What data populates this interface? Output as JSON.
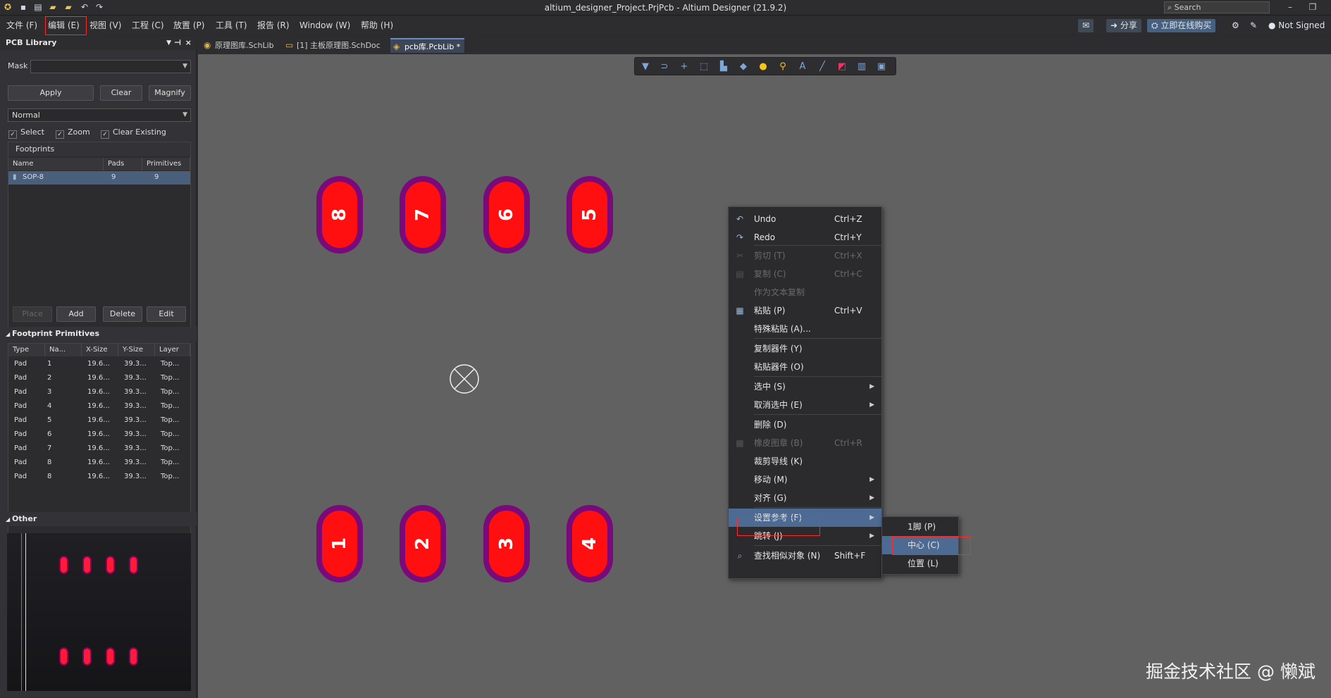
{
  "window": {
    "title": "altium_designer_Project.PrjPcb - Altium Designer (21.9.2)",
    "search_placeholder": "Search",
    "min_label": "–",
    "max_label": "❐"
  },
  "quick_access": [
    "logo-icon",
    "save-icon",
    "save-all-icon",
    "open-icon",
    "open-project-icon",
    "undo-icon",
    "redo-icon"
  ],
  "menu": [
    "文件 (F)",
    "编辑 (E)",
    "视图 (V)",
    "工程 (C)",
    "放置 (P)",
    "工具 (T)",
    "报告 (R)",
    "Window (W)",
    "帮助 (H)"
  ],
  "right_bar": {
    "share": "分享",
    "buy": "立即在线购买",
    "user": "Not Signed"
  },
  "panel": {
    "title": "PCB Library",
    "mask_label": "Mask",
    "mask_value": "",
    "apply": "Apply",
    "clear": "Clear",
    "magnify": "Magnify",
    "mode": "Normal",
    "select": "Select",
    "zoom": "Zoom",
    "clear_existing": "Clear Existing",
    "footprints_title": "Footprints",
    "footprint_columns": [
      "Name",
      "Pads",
      "Primitives"
    ],
    "footprints": [
      {
        "name": "SOP-8",
        "pads": "9",
        "primitives": "9"
      }
    ],
    "place": "Place",
    "add": "Add",
    "delete": "Delete",
    "edit": "Edit",
    "primitives_title": "Footprint Primitives",
    "primitive_columns": [
      "Type",
      "Na...",
      "X-Size",
      "Y-Size",
      "Layer"
    ],
    "primitives": [
      {
        "type": "Pad",
        "name": "1",
        "x": "19.6...",
        "y": "39.3...",
        "layer": "Top..."
      },
      {
        "type": "Pad",
        "name": "2",
        "x": "19.6...",
        "y": "39.3...",
        "layer": "Top..."
      },
      {
        "type": "Pad",
        "name": "3",
        "x": "19.6...",
        "y": "39.3...",
        "layer": "Top..."
      },
      {
        "type": "Pad",
        "name": "4",
        "x": "19.6...",
        "y": "39.3...",
        "layer": "Top..."
      },
      {
        "type": "Pad",
        "name": "5",
        "x": "19.6...",
        "y": "39.3...",
        "layer": "Top..."
      },
      {
        "type": "Pad",
        "name": "6",
        "x": "19.6...",
        "y": "39.3...",
        "layer": "Top..."
      },
      {
        "type": "Pad",
        "name": "7",
        "x": "19.6...",
        "y": "39.3...",
        "layer": "Top..."
      },
      {
        "type": "Pad",
        "name": "8",
        "x": "19.6...",
        "y": "39.3...",
        "layer": "Top..."
      },
      {
        "type": "Pad",
        "name": "8",
        "x": "19.6...",
        "y": "39.3...",
        "layer": "Top..."
      }
    ],
    "other_title": "Other"
  },
  "tabs": [
    {
      "label": "原理图库.SchLib",
      "icon": "schlib-icon"
    },
    {
      "label": "[1] 主板原理图.SchDoc",
      "icon": "schdoc-icon"
    },
    {
      "label": "pcb库.PcbLib *",
      "icon": "pcblib-icon"
    }
  ],
  "pads_top": [
    "8",
    "7",
    "6",
    "5"
  ],
  "pads_bottom": [
    "1",
    "2",
    "3",
    "4"
  ],
  "context_menu": [
    {
      "label": "Undo",
      "shortcut": "Ctrl+Z",
      "icon": "undo-icon",
      "disabled": false
    },
    {
      "label": "Redo",
      "shortcut": "Ctrl+Y",
      "icon": "redo-icon",
      "disabled": false
    },
    {
      "label": "剪切 (T)",
      "shortcut": "Ctrl+X",
      "icon": "cut-icon",
      "disabled": true
    },
    {
      "label": "复制 (C)",
      "shortcut": "Ctrl+C",
      "icon": "copy-icon",
      "disabled": true
    },
    {
      "label": "作为文本复制",
      "shortcut": "",
      "icon": "",
      "disabled": true
    },
    {
      "label": "粘贴 (P)",
      "shortcut": "Ctrl+V",
      "icon": "paste-icon",
      "disabled": false
    },
    {
      "label": "特殊粘贴 (A)...",
      "shortcut": "",
      "icon": "",
      "disabled": false
    },
    {
      "label": "复制器件 (Y)",
      "shortcut": "",
      "icon": "",
      "disabled": false
    },
    {
      "label": "粘贴器件 (O)",
      "shortcut": "",
      "icon": "",
      "disabled": false
    },
    {
      "label": "选中 (S)",
      "shortcut": "",
      "icon": "",
      "disabled": false,
      "submenu": true
    },
    {
      "label": "取消选中 (E)",
      "shortcut": "",
      "icon": "",
      "disabled": false,
      "submenu": true
    },
    {
      "label": "删除 (D)",
      "shortcut": "",
      "icon": "",
      "disabled": false
    },
    {
      "label": "橡皮图章 (B)",
      "shortcut": "Ctrl+R",
      "icon": "rubber-stamp-icon",
      "disabled": true
    },
    {
      "label": "裁剪导线 (K)",
      "shortcut": "",
      "icon": "",
      "disabled": false
    },
    {
      "label": "移动 (M)",
      "shortcut": "",
      "icon": "",
      "disabled": false,
      "submenu": true
    },
    {
      "label": "对齐 (G)",
      "shortcut": "",
      "icon": "",
      "disabled": false,
      "submenu": true
    },
    {
      "label": "设置参考 (F)",
      "shortcut": "",
      "icon": "",
      "disabled": false,
      "submenu": true,
      "highlighted": true
    },
    {
      "label": "跳转 (J)",
      "shortcut": "",
      "icon": "",
      "disabled": false,
      "submenu": true
    },
    {
      "label": "查找相似对象 (N)",
      "shortcut": "Shift+F",
      "icon": "find-icon",
      "disabled": false
    }
  ],
  "submenu": [
    {
      "label": "1脚 (P)",
      "highlighted": false
    },
    {
      "label": "中心 (C)",
      "highlighted": true
    },
    {
      "label": "位置 (L)",
      "highlighted": false
    }
  ],
  "watermark": "掘金技术社区 @ 懒斌",
  "colors": {
    "pad_fill": "#ff0f0f",
    "pad_ring": "#7a0a7a",
    "canvas": "#616161",
    "highlight": "#4c6a92",
    "annotation": "#ff2a2a"
  }
}
